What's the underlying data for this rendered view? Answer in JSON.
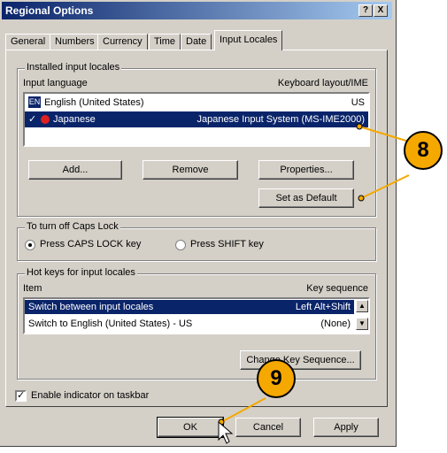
{
  "window": {
    "title": "Regional Options",
    "help_btn": "?",
    "close_btn": "X"
  },
  "tabs": [
    "General",
    "Numbers",
    "Currency",
    "Time",
    "Date",
    "Input Locales"
  ],
  "installed": {
    "group_label": "Installed input locales",
    "col_language": "Input language",
    "col_layout": "Keyboard layout/IME",
    "rows": [
      {
        "badge": "EN",
        "language": "English (United States)",
        "layout": "US"
      },
      {
        "check": "✓",
        "language": "Japanese",
        "layout": "Japanese Input System (MS-IME2000)"
      }
    ],
    "add": "Add...",
    "remove": "Remove",
    "properties": "Properties...",
    "set_default": "Set as Default"
  },
  "capslock": {
    "group_label": "To turn off Caps Lock",
    "opt1": "Press CAPS LOCK key",
    "opt2": "Press SHIFT key",
    "selected": "opt1"
  },
  "hotkeys": {
    "group_label": "Hot keys for input locales",
    "col_item": "Item",
    "col_seq": "Key sequence",
    "rows": [
      {
        "item": "Switch between input locales",
        "seq": "Left Alt+Shift"
      },
      {
        "item": "Switch to English (United States) - US",
        "seq": "(None)"
      }
    ],
    "change_btn": "Change Key Sequence..."
  },
  "indicator": {
    "label": "Enable indicator on taskbar",
    "checked": true
  },
  "footer": {
    "ok": "OK",
    "cancel": "Cancel",
    "apply": "Apply"
  },
  "callouts": {
    "c8": "8",
    "c9": "9"
  },
  "colors": {
    "callout": "#f5a800",
    "selection": "#0a246a",
    "title_start": "#0a246a"
  }
}
